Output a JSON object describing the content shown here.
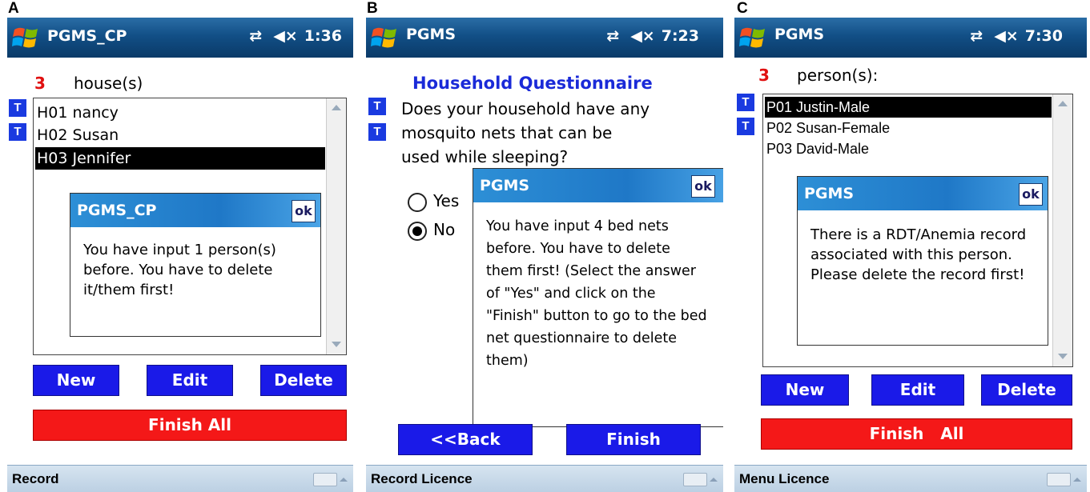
{
  "panels": {
    "a": {
      "letter": "A",
      "window_title": "PGMS_CP",
      "clock": "1:36",
      "count": "3",
      "count_label": "house(s)",
      "items": [
        "H01  nancy",
        "H02  Susan",
        "H03  Jennifer"
      ],
      "dialog": {
        "title": "PGMS_CP",
        "ok": "ok",
        "message": "You have input 1 person(s) before. You have to delete it/them first!"
      },
      "buttons": {
        "new": "New",
        "edit": "Edit",
        "delete": "Delete",
        "finish_all": "Finish All"
      },
      "bottom_menu": "Record"
    },
    "b": {
      "letter": "B",
      "window_title": "PGMS",
      "clock": "7:23",
      "heading": "Household Questionnaire",
      "question_line1": "Does your household have any",
      "question_line2": "mosquito nets that can be",
      "question_line3": "used while sleeping?",
      "options": [
        "Yes",
        "No"
      ],
      "selected_option": "No",
      "dialog": {
        "title": "PGMS",
        "ok": "ok",
        "message": "You have input 4 bed nets before. You have to delete them first! (Select the answer of \"Yes\" and click on the \"Finish\" button to go to the bed net questionnaire to delete them)"
      },
      "buttons": {
        "back": "<<Back",
        "finish": "Finish"
      },
      "bottom_menu": "Record  Licence"
    },
    "c": {
      "letter": "C",
      "window_title": "PGMS",
      "clock": "7:30",
      "count": "3",
      "count_label": "person(s):",
      "items": [
        "P01 Justin-Male",
        "P02 Susan-Female",
        "P03 David-Male"
      ],
      "dialog": {
        "title": "PGMS",
        "ok": "ok",
        "message": "There is a RDT/Anemia record associated with this person. Please delete the record first!"
      },
      "buttons": {
        "new": "New",
        "edit": "Edit",
        "delete": "Delete",
        "finish_all": "Finish   All"
      },
      "bottom_menu": "Menu  Licence"
    }
  },
  "badge_letter": "T",
  "icons": {
    "start": "windows-logo-icon",
    "sync": "sync-arrows-icon",
    "volume": "speaker-muted-icon",
    "keyboard": "keyboard-icon"
  },
  "colors": {
    "titlebar": "#124f86",
    "button_blue": "#1a1ae8",
    "button_red": "#f41818",
    "count_red": "#e01010",
    "heading_blue": "#1a2ad8"
  }
}
